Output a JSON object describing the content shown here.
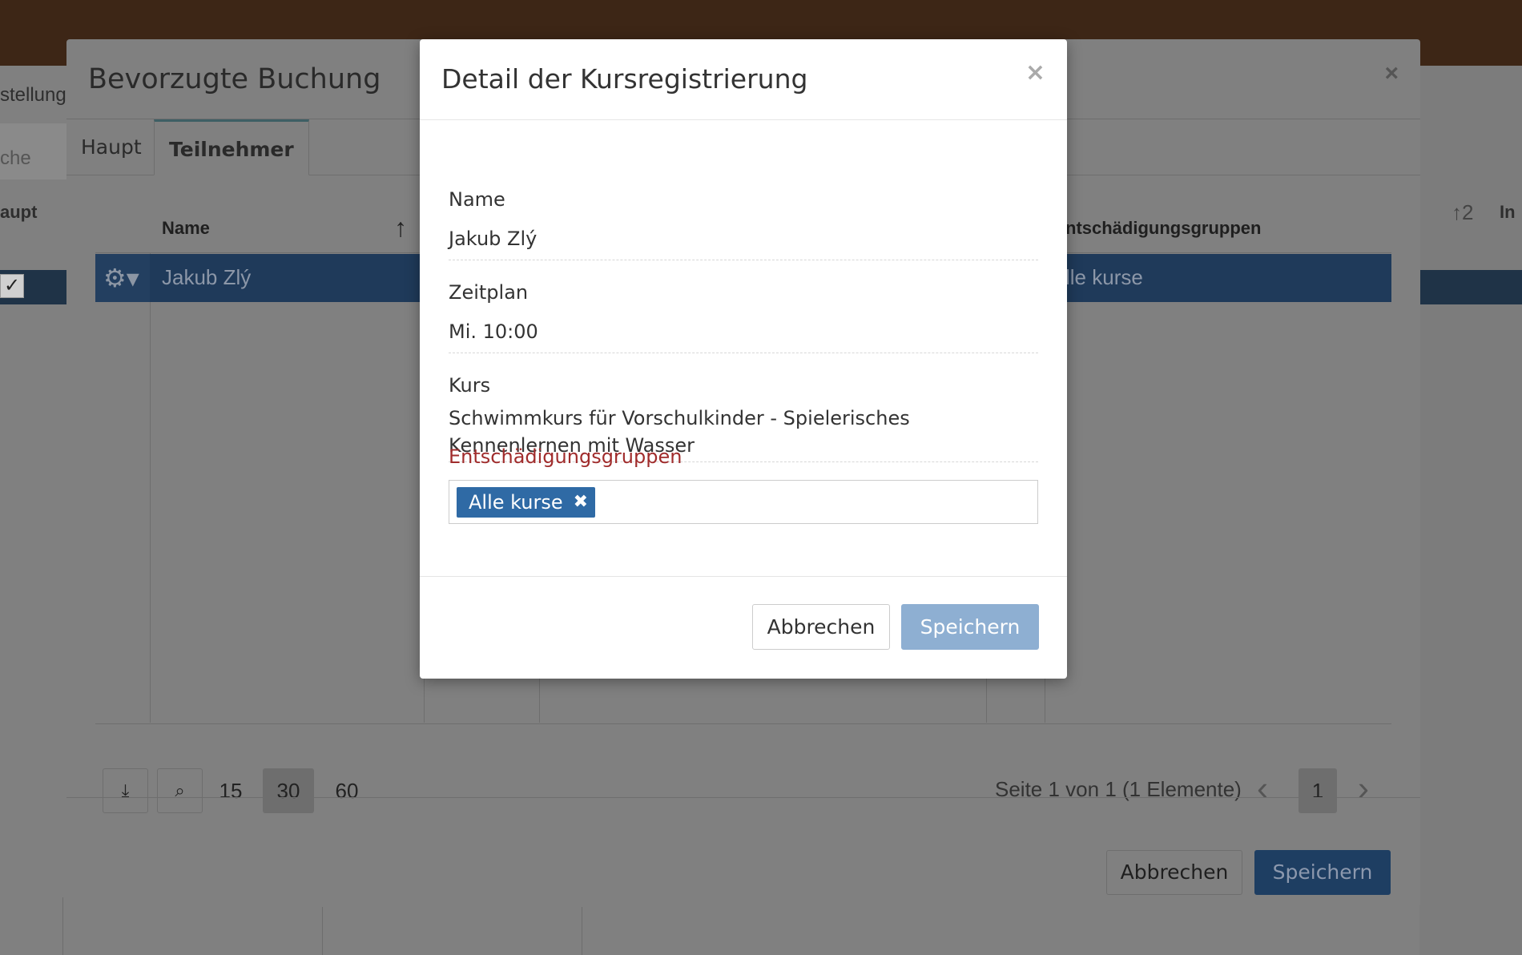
{
  "background": {
    "text_left_1": "stellung",
    "text_left_2": "che",
    "text_left_3": "aupt",
    "text_right_1": "↑2",
    "text_right_2": "In"
  },
  "outer_modal": {
    "title": "Bevorzugte Buchung",
    "tabs": [
      "Haupt",
      "Teilnehmer"
    ],
    "active_tab": "Teilnehmer",
    "grid": {
      "columns": [
        "Name",
        "ntschädigungsgruppen"
      ],
      "rows": [
        {
          "name": "Jakub Zlý",
          "compensation": "lle kurse"
        }
      ]
    },
    "pager": {
      "page_sizes": [
        "15",
        "30",
        "60"
      ],
      "active_page_size": "30",
      "info": "Seite 1 von 1 (1 Elemente)",
      "current_page": "1"
    },
    "cancel_label": "Abbrechen",
    "save_label": "Speichern"
  },
  "inner_modal": {
    "title": "Detail der Kursregistrierung",
    "fields": {
      "name_label": "Name",
      "name_value": "Jakub Zlý",
      "schedule_label": "Zeitplan",
      "schedule_value": "Mi. 10:00",
      "course_label": "Kurs",
      "course_value": "Schwimmkurs für Vorschulkinder - Spielerisches Kennenlernen mit Wasser",
      "groups_label": "Entschädigungsgruppen"
    },
    "tags": [
      "Alle kurse"
    ],
    "cancel_label": "Abbrechen",
    "save_label": "Speichern"
  },
  "colors": {
    "primary": "#2f6aa5",
    "save_disabled": "#8eafd2",
    "required_label": "#a02c2c"
  }
}
